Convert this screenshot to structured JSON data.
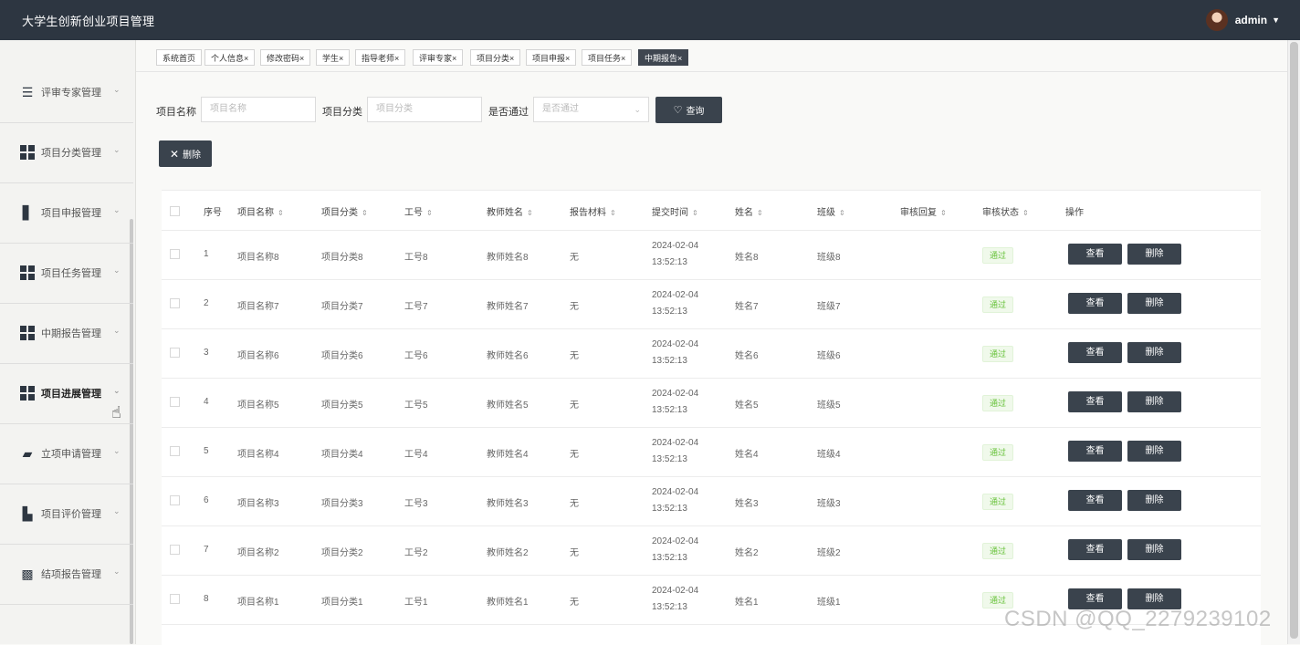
{
  "app": {
    "title": "大学生创新创业项目管理",
    "user": "admin"
  },
  "sidebar": {
    "items": [
      {
        "label": "评审专家管理",
        "icon": "list-icon"
      },
      {
        "label": "项目分类管理",
        "icon": "grid-icon"
      },
      {
        "label": "项目申报管理",
        "icon": "book-icon"
      },
      {
        "label": "项目任务管理",
        "icon": "grid-icon"
      },
      {
        "label": "中期报告管理",
        "icon": "grid-icon"
      },
      {
        "label": "项目进展管理",
        "icon": "grid-icon"
      },
      {
        "label": "立项申请管理",
        "icon": "ticket-icon"
      },
      {
        "label": "项目评价管理",
        "icon": "briefcase-icon"
      },
      {
        "label": "结项报告管理",
        "icon": "chat-icon"
      }
    ]
  },
  "tabs": [
    {
      "label": "系统首页",
      "closable": false
    },
    {
      "label": "个人信息",
      "closable": true
    },
    {
      "label": "修改密码",
      "closable": true
    },
    {
      "label": "学生",
      "closable": true
    },
    {
      "label": "指导老师",
      "closable": true
    },
    {
      "label": "评审专家",
      "closable": true
    },
    {
      "label": "项目分类",
      "closable": true
    },
    {
      "label": "项目申报",
      "closable": true
    },
    {
      "label": "项目任务",
      "closable": true
    },
    {
      "label": "中期报告",
      "closable": true,
      "active": true
    }
  ],
  "search": {
    "name_label": "项目名称",
    "name_placeholder": "项目名称",
    "category_label": "项目分类",
    "category_placeholder": "项目分类",
    "passed_label": "是否通过",
    "passed_placeholder": "是否通过",
    "query_button": "查询"
  },
  "toolbar": {
    "delete_button": "删除"
  },
  "table": {
    "headers": [
      "序号",
      "项目名称",
      "项目分类",
      "工号",
      "教师姓名",
      "报告材料",
      "提交时间",
      "姓名",
      "班级",
      "审核回复",
      "审核状态",
      "操作"
    ],
    "view_label": "查看",
    "delete_label": "删除",
    "rows": [
      {
        "no": "1",
        "name": "项目名称8",
        "category": "项目分类8",
        "job_no": "工号8",
        "teacher": "教师姓名8",
        "material": "无",
        "time": "2024-02-04 13:52:13",
        "student": "姓名8",
        "class": "班级8",
        "reply": "",
        "status": "通过"
      },
      {
        "no": "2",
        "name": "项目名称7",
        "category": "项目分类7",
        "job_no": "工号7",
        "teacher": "教师姓名7",
        "material": "无",
        "time": "2024-02-04 13:52:13",
        "student": "姓名7",
        "class": "班级7",
        "reply": "",
        "status": "通过"
      },
      {
        "no": "3",
        "name": "项目名称6",
        "category": "项目分类6",
        "job_no": "工号6",
        "teacher": "教师姓名6",
        "material": "无",
        "time": "2024-02-04 13:52:13",
        "student": "姓名6",
        "class": "班级6",
        "reply": "",
        "status": "通过"
      },
      {
        "no": "4",
        "name": "项目名称5",
        "category": "项目分类5",
        "job_no": "工号5",
        "teacher": "教师姓名5",
        "material": "无",
        "time": "2024-02-04 13:52:13",
        "student": "姓名5",
        "class": "班级5",
        "reply": "",
        "status": "通过"
      },
      {
        "no": "5",
        "name": "项目名称4",
        "category": "项目分类4",
        "job_no": "工号4",
        "teacher": "教师姓名4",
        "material": "无",
        "time": "2024-02-04 13:52:13",
        "student": "姓名4",
        "class": "班级4",
        "reply": "",
        "status": "通过"
      },
      {
        "no": "6",
        "name": "项目名称3",
        "category": "项目分类3",
        "job_no": "工号3",
        "teacher": "教师姓名3",
        "material": "无",
        "time": "2024-02-04 13:52:13",
        "student": "姓名3",
        "class": "班级3",
        "reply": "",
        "status": "通过"
      },
      {
        "no": "7",
        "name": "项目名称2",
        "category": "项目分类2",
        "job_no": "工号2",
        "teacher": "教师姓名2",
        "material": "无",
        "time": "2024-02-04 13:52:13",
        "student": "姓名2",
        "class": "班级2",
        "reply": "",
        "status": "通过"
      },
      {
        "no": "8",
        "name": "项目名称1",
        "category": "项目分类1",
        "job_no": "工号1",
        "teacher": "教师姓名1",
        "material": "无",
        "time": "2024-02-04 13:52:13",
        "student": "姓名1",
        "class": "班级1",
        "reply": "",
        "status": "通过"
      }
    ]
  },
  "watermark": "CSDN @QQ_2279239102"
}
